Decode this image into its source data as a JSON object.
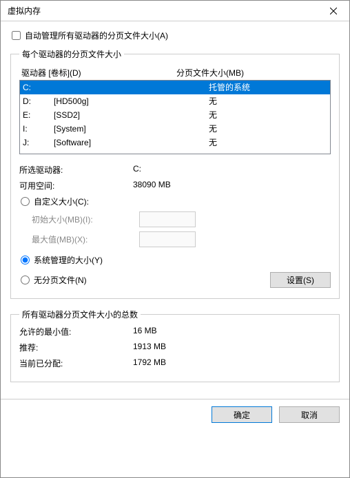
{
  "window": {
    "title": "虚拟内存"
  },
  "auto_manage": {
    "label": "自动管理所有驱动器的分页文件大小(A)",
    "checked": false
  },
  "per_drive": {
    "legend": "每个驱动器的分页文件大小",
    "col_drive": "驱动器 [卷标](D)",
    "col_size": "分页文件大小(MB)",
    "rows": [
      {
        "drive": "C:",
        "label": "",
        "size": "托管的系统",
        "selected": true
      },
      {
        "drive": "D:",
        "label": "[HD500g]",
        "size": "无",
        "selected": false
      },
      {
        "drive": "E:",
        "label": "[SSD2]",
        "size": "无",
        "selected": false
      },
      {
        "drive": "I:",
        "label": "[System]",
        "size": "无",
        "selected": false
      },
      {
        "drive": "J:",
        "label": "[Software]",
        "size": "无",
        "selected": false
      }
    ],
    "selected_drive_label": "所选驱动器:",
    "selected_drive_value": "C:",
    "space_label": "可用空间:",
    "space_value": "38090 MB",
    "custom_radio": "自定义大小(C):",
    "initial_label": "初始大小(MB)(I):",
    "max_label": "最大值(MB)(X):",
    "system_radio": "系统管理的大小(Y)",
    "none_radio": "无分页文件(N)",
    "set_btn": "设置(S)"
  },
  "totals": {
    "legend": "所有驱动器分页文件大小的总数",
    "min_label": "允许的最小值:",
    "min_value": "16 MB",
    "rec_label": "推荐:",
    "rec_value": "1913 MB",
    "cur_label": "当前已分配:",
    "cur_value": "1792 MB"
  },
  "footer": {
    "ok": "确定",
    "cancel": "取消"
  }
}
